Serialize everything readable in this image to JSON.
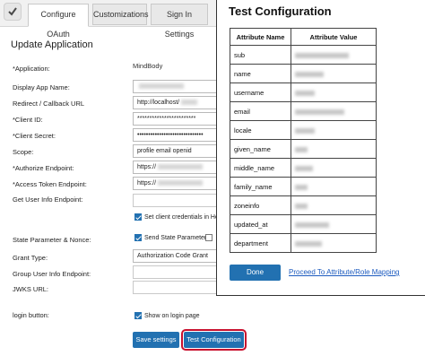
{
  "tabs": [
    {
      "label": "Configure OAuth",
      "active": true
    },
    {
      "label": "Customizations",
      "active": false
    },
    {
      "label": "Sign In Settings",
      "active": false
    }
  ],
  "form": {
    "title": "Update Application",
    "application_label": "*Application:",
    "application_value": "MindBody",
    "display_name_label": "Display App Name:",
    "redirect_label": "Redirect / Callback URL",
    "redirect_value": "http://localhost/",
    "client_id_label": "*Client ID:",
    "client_id_value": "************************",
    "client_secret_label": "*Client Secret:",
    "client_secret_value": "••••••••••••••••••••••••••••••",
    "scope_label": "Scope:",
    "scope_value": "profile email openid",
    "authorize_label": "*Authorize Endpoint:",
    "authorize_value": "https://",
    "token_label": "*Access Token Endpoint:",
    "token_value": "https://",
    "userinfo_label": "Get User Info Endpoint:",
    "set_credentials_label": "Set client credentials in Hea",
    "state_label": "State Parameter & Nonce:",
    "send_state_label": "Send State Parameter",
    "grant_label": "Grant Type:",
    "grant_value": "Authorization Code Grant",
    "group_userinfo_label": "Group User Info Endpoint:",
    "jwks_label": "JWKS URL:",
    "login_button_label": "login button:",
    "show_login_label": "Show on login page",
    "save_label": "Save settings",
    "test_label": "Test Configuration"
  },
  "popup": {
    "title": "Test Configuration",
    "col_attribute": "Attribute Name",
    "col_value": "Attribute Value",
    "rows": [
      "sub",
      "name",
      "username",
      "email",
      "locale",
      "given_name",
      "middle_name",
      "family_name",
      "zoneinfo",
      "updated_at",
      "department"
    ],
    "done_label": "Done",
    "proceed_label": "Proceed To Attribute/Role Mapping"
  },
  "colors": {
    "primary": "#2271b1",
    "highlight": "#c8102e",
    "link": "#1d5bbf"
  }
}
